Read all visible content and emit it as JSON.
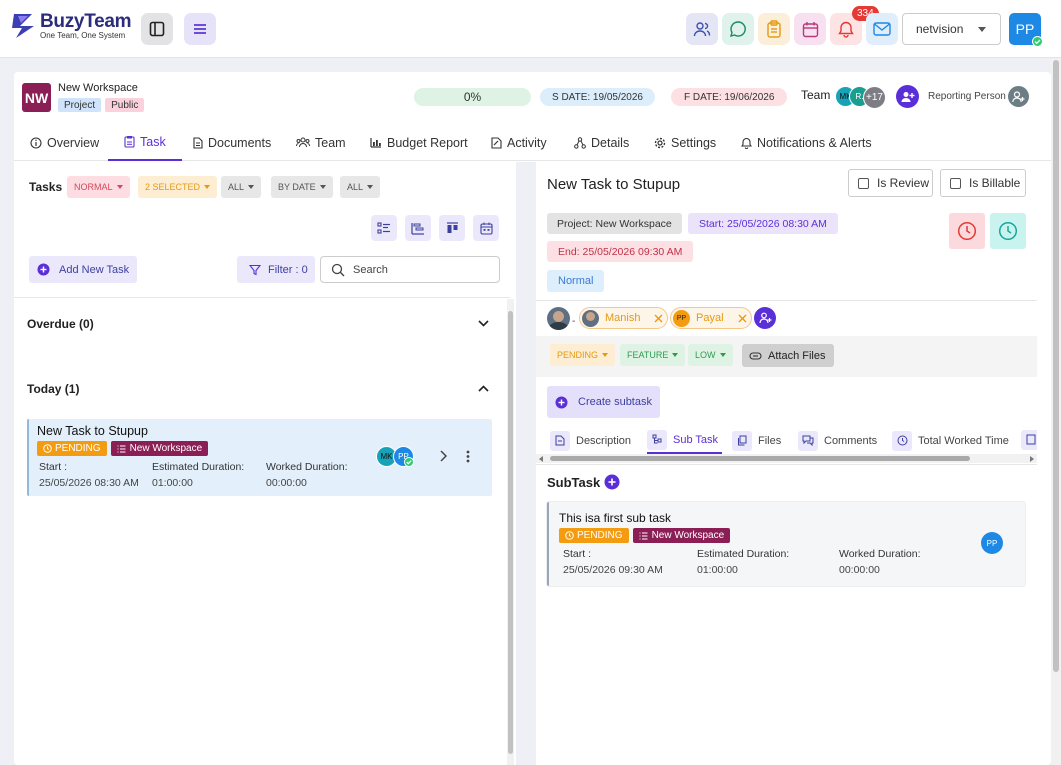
{
  "app": {
    "brand": "BuzyTeam",
    "tagline": "One Team, One System",
    "notifications_count": "334",
    "org_name": "netvision",
    "user_initials": "PP"
  },
  "project": {
    "avatar": "NW",
    "name": "New Workspace",
    "tag_type": "Project",
    "tag_visibility": "Public",
    "progress": "0%",
    "progress_value": 0,
    "start_date": "S DATE: 19/05/2026",
    "finish_date": "F DATE: 19/06/2026",
    "team_label": "Team",
    "team_avatar_1": "MK",
    "team_avatar_2": "R.",
    "team_more": "+17",
    "reporting_label": "Reporting Person"
  },
  "tabs": [
    {
      "label": "Overview",
      "icon": "info-icon"
    },
    {
      "label": "Task",
      "icon": "clipboard-icon"
    },
    {
      "label": "Documents",
      "icon": "document-icon"
    },
    {
      "label": "Team",
      "icon": "team-icon"
    },
    {
      "label": "Budget Report",
      "icon": "chart-icon"
    },
    {
      "label": "Activity",
      "icon": "activity-icon"
    },
    {
      "label": "Details",
      "icon": "details-icon"
    },
    {
      "label": "Settings",
      "icon": "gear-icon"
    },
    {
      "label": "Notifications & Alerts",
      "icon": "bell-icon"
    }
  ],
  "left": {
    "tasks_label": "Tasks",
    "filter_normal": "NORMAL",
    "filter_selected": "2 SELECTED",
    "filter_all_1": "ALL",
    "filter_date": "BY DATE",
    "filter_all_2": "ALL",
    "add_task": "Add New Task",
    "filter_count": "Filter : 0",
    "search_placeholder": "Search",
    "overdue": "Overdue (0)",
    "today": "Today (1)",
    "task": {
      "title": "New Task to Stupup",
      "status": "PENDING",
      "workspace": "New Workspace",
      "start_label": "Start :",
      "start_value": "25/05/2026 08:30 AM",
      "est_label": "Estimated Duration:",
      "est_value": "01:00:00",
      "worked_label": "Worked Duration:",
      "worked_value": "00:00:00",
      "avatar_1": "MK",
      "avatar_2": "PP"
    }
  },
  "right": {
    "title": "New Task to Stupup",
    "is_review": "Is Review",
    "is_billable": "Is Billable",
    "project": "Project: New Workspace",
    "start": "Start: 25/05/2026 08:30 AM",
    "end": "End: 25/05/2026 09:30 AM",
    "priority": "Normal",
    "assignee_1": "Manish",
    "assignee_2": "Payal",
    "assignee_2_initials": "PP",
    "status": "PENDING",
    "type": "FEATURE",
    "level": "LOW",
    "attach": "Attach Files",
    "create_subtask": "Create subtask",
    "sub_tabs": [
      {
        "label": "Description"
      },
      {
        "label": "Sub Task"
      },
      {
        "label": "Files"
      },
      {
        "label": "Comments"
      },
      {
        "label": "Total Worked Time"
      }
    ],
    "subtask_heading": "SubTask",
    "subtask": {
      "title": "This isa first sub task",
      "status": "PENDING",
      "workspace": "New Workspace",
      "start_label": "Start :",
      "start_value": "25/05/2026 09:30 AM",
      "est_label": "Estimated Duration:",
      "est_value": "01:00:00",
      "worked_label": "Worked Duration:",
      "worked_value": "00:00:00",
      "avatar": "PP"
    }
  },
  "colors": {
    "accent": "#5b2fd8",
    "brand": "#2b2d7c",
    "pending": "#f39c12",
    "workspace_tag": "#8b1e54"
  }
}
